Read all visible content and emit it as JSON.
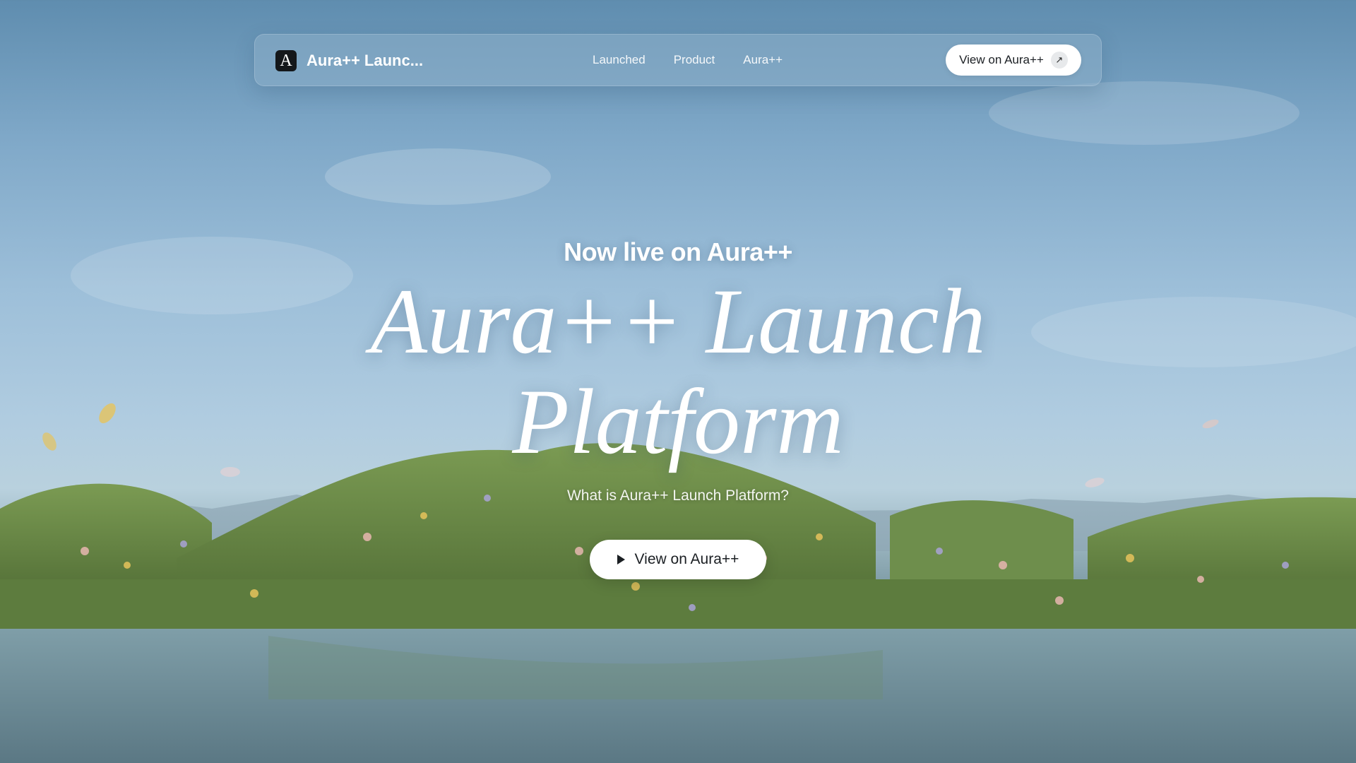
{
  "nav": {
    "brand_logo_letter": "A",
    "brand_name": "Aura++ Launc...",
    "links": [
      "Launched",
      "Product",
      "Aura++"
    ],
    "cta_label": "View on Aura++",
    "cta_icon": "arrow-up-right-icon"
  },
  "hero": {
    "eyebrow": "Now live on Aura++",
    "title_line1": "Aura++ Launch",
    "title_line2": "Platform",
    "subtitle": "What is Aura++ Launch Platform?",
    "cta_label": "View on Aura++",
    "cta_icon": "play-icon"
  },
  "colors": {
    "accent": "#ffffff",
    "text_dark": "#1b1f23",
    "logo_bg": "#14171a"
  }
}
